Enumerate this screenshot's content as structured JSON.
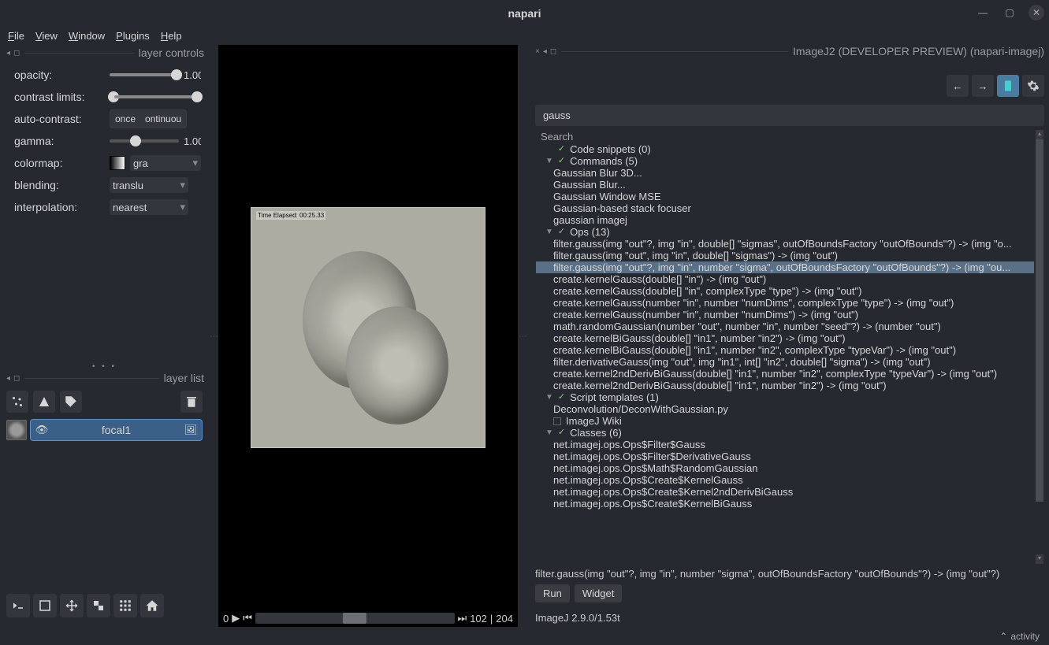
{
  "app_title": "napari",
  "menus": {
    "file": "File",
    "view": "View",
    "window": "Window",
    "plugins": "Plugins",
    "help": "Help"
  },
  "layer_controls": {
    "title": "layer controls",
    "opacity_label": "opacity:",
    "opacity_val": "1.00",
    "contrast_label": "contrast limits:",
    "autocontrast_label": "auto-contrast:",
    "ac_once": "once",
    "ac_cont": "ontinuou",
    "gamma_label": "gamma:",
    "gamma_val": "1.00",
    "colormap_label": "colormap:",
    "colormap_val": "gra",
    "blending_label": "blending:",
    "blending_val": "translu",
    "interp_label": "interpolation:",
    "interp_val": "nearest"
  },
  "layer_list": {
    "title": "layer list",
    "layer_name": "focal1"
  },
  "canvas": {
    "time_label": "Time Elapsed: 00:25.33",
    "dim_start": "0",
    "dim_cur": "102",
    "dim_sep": " | ",
    "dim_max": "204"
  },
  "ij_panel": {
    "title": "ImageJ2 (DEVELOPER PREVIEW) (napari-imagej)",
    "search_value": "gauss",
    "search_header": "Search",
    "code_snippets": "Code snippets (0)",
    "commands_hdr": "Commands (5)",
    "commands": [
      "Gaussian Blur 3D...",
      "Gaussian Blur...",
      "Gaussian Window MSE",
      "Gaussian-based stack focuser",
      "gaussian imagej"
    ],
    "ops_hdr": "Ops (13)",
    "ops": [
      "filter.gauss(img \"out\"?, img \"in\", double[] \"sigmas\", outOfBoundsFactory \"outOfBounds\"?) -> (img \"o...",
      "filter.gauss(img \"out\", img \"in\", double[] \"sigmas\") -> (img \"out\")",
      "filter.gauss(img \"out\"?, img \"in\", number \"sigma\", outOfBoundsFactory \"outOfBounds\"?) -> (img \"ou...",
      "create.kernelGauss(double[] \"in\") -> (img \"out\")",
      "create.kernelGauss(double[] \"in\", complexType \"type\") -> (img \"out\")",
      "create.kernelGauss(number \"in\", number \"numDims\", complexType \"type\") -> (img \"out\")",
      "create.kernelGauss(number \"in\", number \"numDims\") -> (img \"out\")",
      "math.randomGaussian(number \"out\", number \"in\", number \"seed\"?) -> (number \"out\")",
      "create.kernelBiGauss(double[] \"in1\", number \"in2\") -> (img \"out\")",
      "create.kernelBiGauss(double[] \"in1\", number \"in2\", complexType \"typeVar\") -> (img \"out\")",
      "filter.derivativeGauss(img \"out\", img \"in1\", int[] \"in2\", double[] \"sigma\") -> (img \"out\")",
      "create.kernel2ndDerivBiGauss(double[] \"in1\", number \"in2\", complexType \"typeVar\") -> (img \"out\")",
      "create.kernel2ndDerivBiGauss(double[] \"in1\", number \"in2\") -> (img \"out\")"
    ],
    "selected_op_index": 2,
    "scripts_hdr": "Script templates (1)",
    "scripts": [
      "Deconvolution/DeconWithGaussian.py"
    ],
    "wiki": "ImageJ Wiki",
    "classes_hdr": "Classes (6)",
    "classes": [
      "net.imagej.ops.Ops$Filter$Gauss",
      "net.imagej.ops.Ops$Filter$DerivativeGauss",
      "net.imagej.ops.Ops$Math$RandomGaussian",
      "net.imagej.ops.Ops$Create$KernelGauss",
      "net.imagej.ops.Ops$Create$Kernel2ndDerivBiGauss",
      "net.imagej.ops.Ops$Create$KernelBiGauss"
    ],
    "status": "filter.gauss(img \"out\"?, img \"in\", number \"sigma\", outOfBoundsFactory \"outOfBounds\"?) -> (img \"out\"?)",
    "run_btn": "Run",
    "widget_btn": "Widget",
    "version": "ImageJ 2.9.0/1.53t"
  },
  "footer": {
    "activity": "activity"
  }
}
